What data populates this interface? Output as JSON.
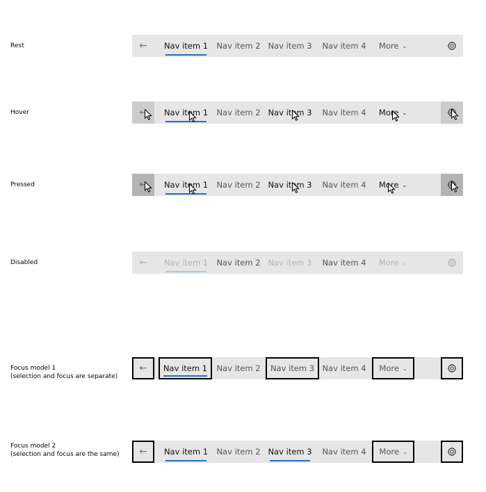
{
  "rows": [
    {
      "key": "rest",
      "label": "Rest",
      "back": "←",
      "items": [
        "Nav item 1",
        "Nav item 2",
        "Nav item 3",
        "Nav item 4"
      ],
      "more": "More",
      "chevron": "⌄",
      "settings_icon": "gear-icon"
    },
    {
      "key": "hover",
      "label": "Hover",
      "back": "←",
      "items": [
        "Nav item 1",
        "Nav item 2",
        "Nav item 3",
        "Nav item 4"
      ],
      "more": "More",
      "chevron": "⌄",
      "settings_icon": "gear-icon"
    },
    {
      "key": "pressed",
      "label": "Pressed",
      "back": "←",
      "items": [
        "Nav item 1",
        "Nav item 2",
        "Nav item 3",
        "Nav item 4"
      ],
      "more": "More",
      "chevron": "⌄",
      "settings_icon": "gear-icon"
    },
    {
      "key": "disabled",
      "label": "Disabled",
      "back": "←",
      "items": [
        "Nav item 1",
        "Nav item 2",
        "Nav item 3",
        "Nav item 4"
      ],
      "more": "More",
      "chevron": "⌄",
      "settings_icon": "gear-icon"
    },
    {
      "key": "focus1",
      "label": "Focus model 1\n(selection and focus are separate)",
      "back": "←",
      "items": [
        "Nav item 1",
        "Nav item 2",
        "Nav item 3",
        "Nav item 4"
      ],
      "more": "More",
      "chevron": "⌄",
      "settings_icon": "gear-icon"
    },
    {
      "key": "focus2",
      "label": "Focus model 2\n(selection and focus are the same)",
      "back": "←",
      "items": [
        "Nav item 1",
        "Nav item 2",
        "Nav item 3",
        "Nav item 4"
      ],
      "more": "More",
      "chevron": "⌄",
      "settings_icon": "gear-icon"
    }
  ],
  "colors": {
    "bar": "#e6e6e6",
    "hover": "#cccccc",
    "pressed": "#b3b3b3",
    "selection_underline": "#1f6fce",
    "focus_border": "#000000"
  }
}
